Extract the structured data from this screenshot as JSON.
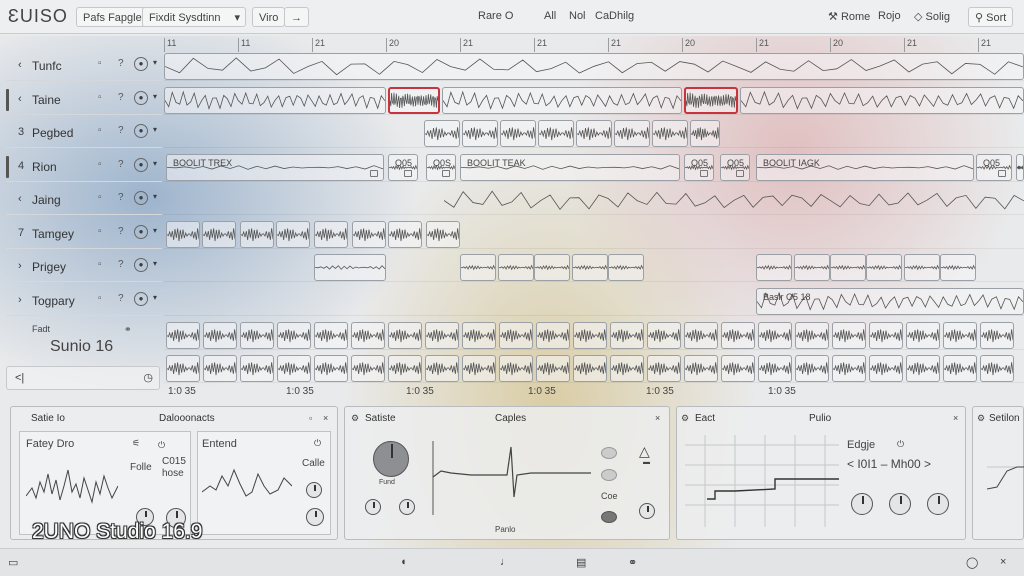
{
  "app": {
    "logo": "ƐUISO"
  },
  "toolbar": {
    "menu_a": "Pafs Fapgles",
    "menu_b": "Fixdit Sysdtinn",
    "menu_c": "Viro",
    "center_a": "Rare O",
    "center_b": "All",
    "center_c": "Nol",
    "center_d": "CaDhilg",
    "right_a": "Rome",
    "right_b": "Rojo",
    "right_c": "Solig",
    "right_d": "Sort"
  },
  "ruler": {
    "labels": [
      "11",
      "11",
      "21",
      "20",
      "21",
      "21",
      "21",
      "20",
      "21",
      "20",
      "21",
      "21"
    ]
  },
  "tracks": [
    {
      "num": "",
      "name": "Tunfc"
    },
    {
      "num": "",
      "name": "Taine"
    },
    {
      "num": "3",
      "name": "Pegbed"
    },
    {
      "num": "4",
      "name": "Rion"
    },
    {
      "num": "",
      "name": "Jaing"
    },
    {
      "num": "7",
      "name": "Tamgey"
    },
    {
      "num": "",
      "name": "Prigey"
    },
    {
      "num": "",
      "name": "Togpary"
    }
  ],
  "track_icons": {
    "a": "▫",
    "b": "?",
    "c": "●"
  },
  "footer": {
    "small": "Fadt",
    "project": "Sunio 16",
    "back": "<|",
    "clock": "◷"
  },
  "clip_labels": {
    "rec1": "BOOLIT TREX",
    "rec2": "BOOLIT TEAK",
    "rec3": "BOOLIT IAGK",
    "o1": "O05",
    "o2": "O0S",
    "o3": "O05",
    "o4": "O05",
    "o5": "O05",
    "o6": "O05",
    "long": "Baslr O5 18"
  },
  "time_labels": [
    "1:0 35",
    "1:0 35",
    "1:0 35",
    "1:0 35",
    "1:0 35",
    "1:0 35"
  ],
  "panels": {
    "p1": {
      "title": "Satie Io",
      "sub": "Dalooonacts",
      "l1": "Fatey Dro",
      "l2": "Entend",
      "l3": "Folle",
      "l4": "Calle",
      "v1": "C015",
      "v2": "hose"
    },
    "p2": {
      "title": "Satiste",
      "sub": "Caples",
      "l1": "Coe",
      "knob_label": "Fund",
      "bottom": "Panlo"
    },
    "p3": {
      "title": "Eact",
      "sub": "Pulio",
      "l1": "Edgje",
      "value": "< I0I1 – Mh00 >"
    },
    "p4": {
      "title": "Setilon"
    }
  },
  "watermark": "2UNO Studio 16.9"
}
